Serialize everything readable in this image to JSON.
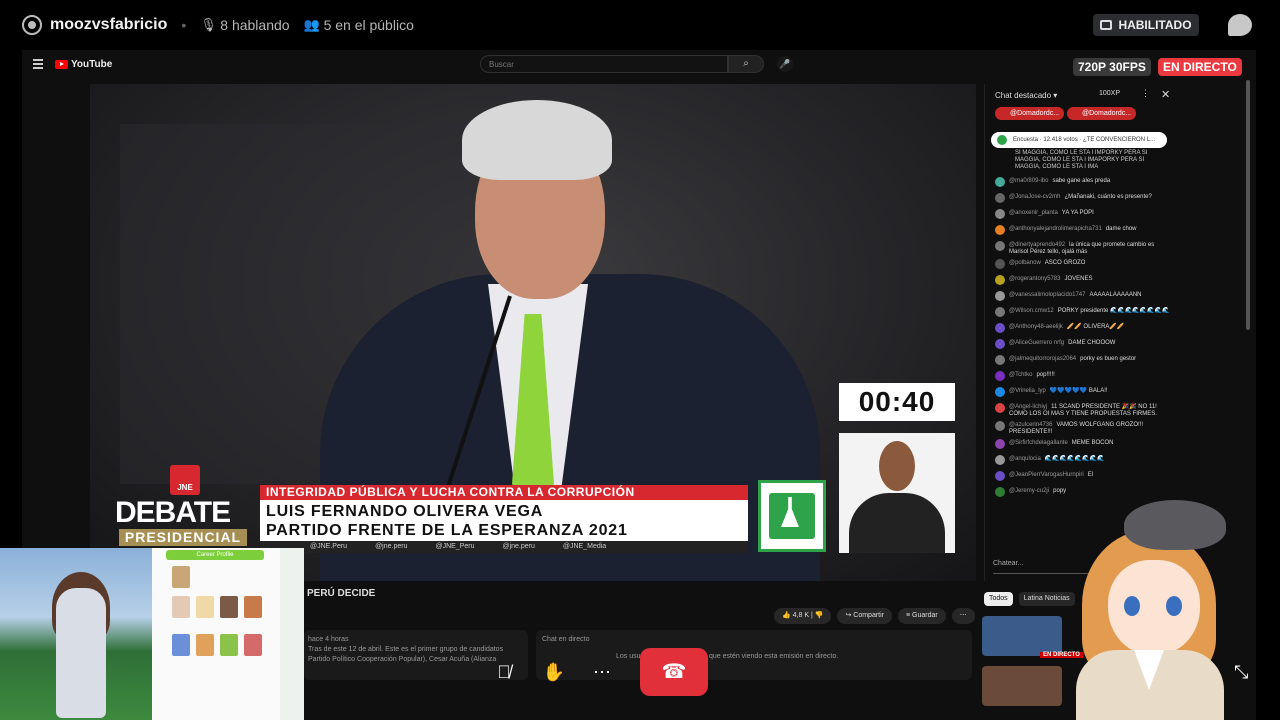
{
  "topbar": {
    "channel": "moozvsfabricio",
    "speaking": "8 hablando",
    "audience": "5 en el público",
    "habilitado": "HABILITADO"
  },
  "stream": {
    "quality": "720P 30FPS",
    "live": "EN DIRECTO"
  },
  "youtube": {
    "logo": "YouTube",
    "search_placeholder": "Buscar"
  },
  "video": {
    "timer": "00:40",
    "debate": "DEBATE",
    "presidencial": "PRESIDENCIAL",
    "ine": "JNE",
    "topic": "INTEGRIDAD PÚBLICA Y LUCHA CONTRA LA CORRUPCIÓN",
    "name": "LUIS FERNANDO OLIVERA VEGA",
    "party": "PARTIDO FRENTE DE LA ESPERANZA 2021",
    "socials": [
      "@JNE.Peru",
      "@jne.peru",
      "@JNE_Peru",
      "@jne.peru",
      "@JNE_Media"
    ]
  },
  "below": {
    "title": "PERÚ DECIDE",
    "likes": "4,8 K",
    "share": "Compartir",
    "save": "Guardar",
    "desc_line1": "hace 4 horas",
    "desc_line2": "Tras de este 12 de abril. Este es el primer grupo de candidatos",
    "desc_line3": "Partido Político Cooperación Popular), Cesar Acuña (Alianza",
    "chat_title": "Chat en directo",
    "chat_sub": "Los usuarios y otros usuarios que estén viendo esta emisión en directo."
  },
  "chat": {
    "header": "Chat destacado",
    "viewers": "100XP",
    "donors": [
      "@Domadordc...",
      "@Domadordc..."
    ],
    "poll": "Encuesta · 12.418 votos · ¿TE CONVENCIERON L...",
    "pinned": "SI MAGGIA, COMO LE STA I IMPORKY PERA SI MAGGIA, COMO LE STA I IMAPORKY PERA SI MAGGIA, COMO LE STA I IMA",
    "input_placeholder": "Chatear...",
    "messages": [
      {
        "author": "@ma0/809-ibo",
        "text": "sabe gane ales preda",
        "color": "#4a9"
      },
      {
        "author": "@JonaJose-cv2mh",
        "text": "¿Mañanaki, cuánto es presente?",
        "color": "#666"
      },
      {
        "author": "@anoxenir_planta",
        "text": "YA YA POPI",
        "color": "#888"
      },
      {
        "author": "@anthonyalejandrolimerapicha731",
        "text": "dame chow",
        "color": "#e67e22"
      },
      {
        "author": "@dinertyaprendo492",
        "text": "la única que promete cambio es Marisol Pérez tello, ojalá más",
        "color": "#777"
      },
      {
        "author": "@polbanow",
        "text": "ASCO GROZO",
        "color": "#555"
      },
      {
        "author": "@rogerantony5783",
        "text": "JOVENES",
        "color": "#b8a020"
      },
      {
        "author": "@vanessalimoloplacido1747",
        "text": "AAAAALAAAAANN",
        "color": "#999"
      },
      {
        "author": "@Wilson.cmw12",
        "text": "PORKY presidente 🌊🌊🌊🌊🌊🌊🌊🌊",
        "color": "#777"
      },
      {
        "author": "@Anthony48-aeelijk",
        "text": "🥖🥖 OLIVERA🥖🥖",
        "color": "#6a4fc8"
      },
      {
        "author": "@AliceGuerrero nrfg",
        "text": "DAME CHOOOW",
        "color": "#6a4fc8"
      },
      {
        "author": "@jalmequitorrorojas2064",
        "text": "porky es buen gestor",
        "color": "#777"
      },
      {
        "author": "@Tchtko",
        "text": "pop!!!!!",
        "color": "#7b2fbf"
      },
      {
        "author": "@Vrinelia_lyp",
        "text": "💙💙💙💙💙 BALA!!",
        "color": "#1e88e5"
      },
      {
        "author": "@Angel-lichiyj",
        "text": "11 SCAND PRESIDENTE 🎉🎉 NO 11! COMO LOS OI MAS Y TIENE PROPUESTAS FIRMES.",
        "color": "#d84343"
      },
      {
        "author": "@azulcerin4736",
        "text": "VAMOS WOLFGANG GROZO!!! PRESIDENTE!!!",
        "color": "#777"
      },
      {
        "author": "@Sirfirfchdelagallante",
        "text": "MEME BOCON",
        "color": "#8e44ad"
      },
      {
        "author": "@anqulocia",
        "text": "🌊🌊🌊🌊🌊🌊🌊🌊",
        "color": "#999"
      },
      {
        "author": "@JeanPierrVarogasHurnpiri",
        "text": "El",
        "color": "#6a4fc8"
      },
      {
        "author": "@Jeremy-cu2ji",
        "text": "popy",
        "color": "#2e7d32"
      }
    ]
  },
  "related": {
    "tabs": [
      "Todos",
      "Latina Noticias"
    ],
    "live_badge": "EN DIRECTO"
  },
  "profile_tile": {
    "title": "Career Profile"
  },
  "controls": {
    "mute_icon": "mic-off-icon",
    "hand_icon": "raise-hand-icon",
    "more_icon": "more-icon",
    "end_icon": "end-call-icon"
  }
}
